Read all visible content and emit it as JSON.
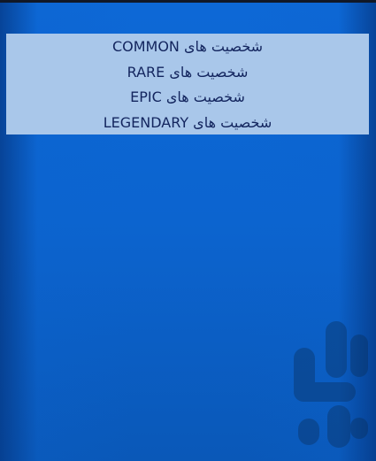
{
  "menu": {
    "items": [
      {
        "label": "شخصیت های COMMON"
      },
      {
        "label": "شخصیت های RARE"
      },
      {
        "label": "شخصیت های EPIC"
      },
      {
        "label": "شخصیت های LEGENDARY"
      }
    ]
  },
  "colors": {
    "background": "#0a63c6",
    "panel": "#a9c7ea",
    "text": "#13255e"
  },
  "icons": {
    "watermark": "bazaar-logo-icon"
  }
}
